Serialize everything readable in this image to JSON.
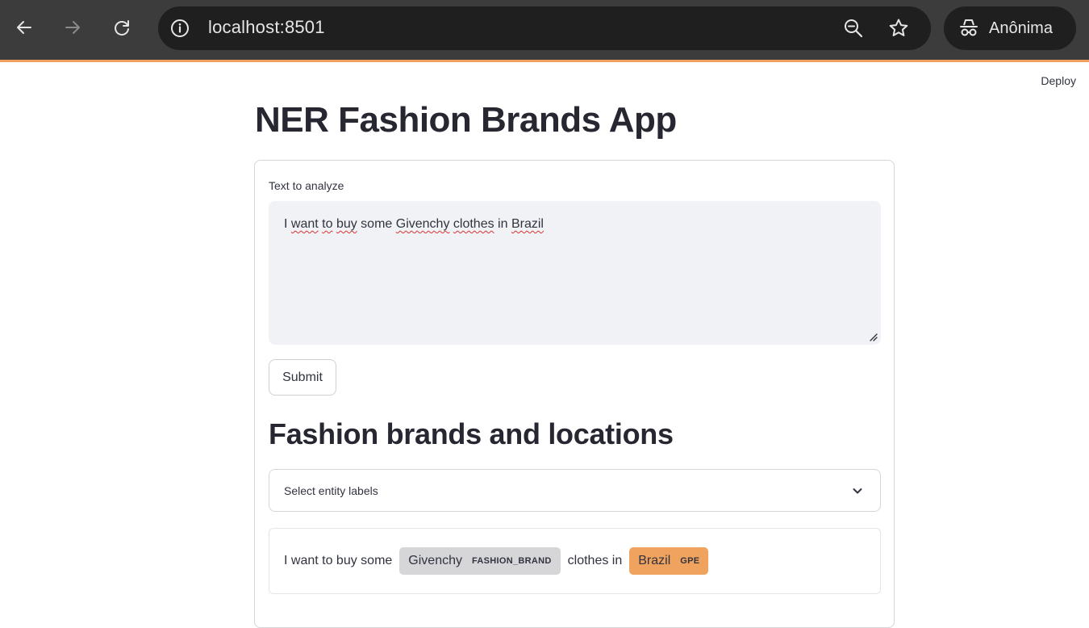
{
  "browser": {
    "url": "localhost:8501",
    "profile_label": "Anônima",
    "colors": {
      "frame": "#3c3c3c",
      "omnibox": "#1f1f1f",
      "accent": "#f0a060"
    }
  },
  "toolbar": {
    "deploy_label": "Deploy"
  },
  "app": {
    "title": "NER Fashion Brands App",
    "form": {
      "text_label": "Text to analyze",
      "text_value": {
        "p1": "I ",
        "w_want": "want",
        "p2": " ",
        "w_to": "to",
        "p3": " ",
        "w_buy": "buy",
        "p4": " some ",
        "w_givenchy": "Givenchy",
        "p5": " ",
        "w_clothes": "clothes",
        "p6": " in ",
        "w_brazil": "Brazil"
      },
      "submit_label": "Submit"
    },
    "results": {
      "heading": "Fashion brands and locations",
      "select_placeholder": "Select entity labels",
      "segments": [
        {
          "text": "I want to buy some"
        },
        {
          "text": "Givenchy",
          "label": "FASHION_BRAND",
          "color": "#d6d6d9"
        },
        {
          "text": "clothes in"
        },
        {
          "text": "Brazil",
          "label": "GPE",
          "color": "#f0a35e"
        }
      ]
    }
  }
}
